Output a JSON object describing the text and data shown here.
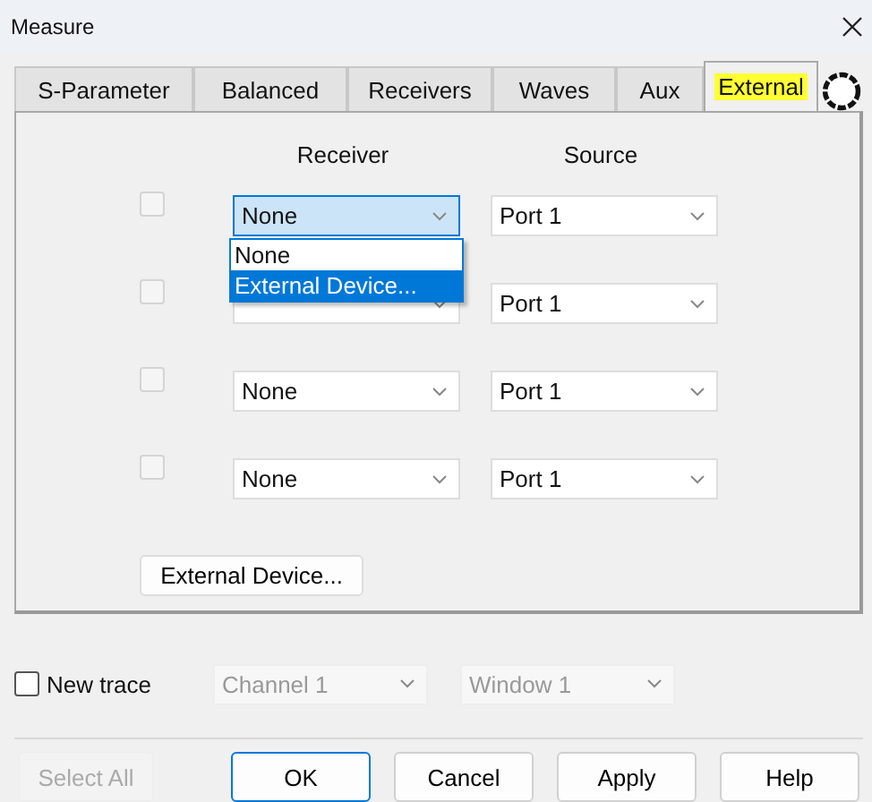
{
  "window": {
    "title": "Measure"
  },
  "tabs": [
    {
      "label": "S-Parameter",
      "selected": false
    },
    {
      "label": "Balanced",
      "selected": false
    },
    {
      "label": "Receivers",
      "selected": false
    },
    {
      "label": "Waves",
      "selected": false
    },
    {
      "label": "Aux",
      "selected": false
    },
    {
      "label": "External",
      "selected": true
    }
  ],
  "columns": [
    "Receiver",
    "Source"
  ],
  "rows": [
    {
      "checked": false,
      "receiver": "None",
      "source": "Port 1",
      "focused": true
    },
    {
      "checked": false,
      "source": "Port 1",
      "focused": false
    },
    {
      "checked": false,
      "receiver": "None",
      "source": "Port 1",
      "focused": false
    },
    {
      "checked": false,
      "receiver": "None",
      "source": "Port 1",
      "focused": false
    }
  ],
  "dropdown": {
    "options": [
      {
        "label": "None",
        "selected": false
      },
      {
        "label": "External Device...",
        "selected": true
      }
    ]
  },
  "external_device_button": "External Device...",
  "new_trace": {
    "label": "New trace",
    "checked": false,
    "channel": {
      "value": "Channel 1",
      "disabled": true
    },
    "window": {
      "value": "Window 1",
      "disabled": true
    }
  },
  "buttons": [
    {
      "label": "Select All",
      "disabled": true,
      "default": false
    },
    {
      "label": "OK",
      "disabled": false,
      "default": true
    },
    {
      "label": "Cancel",
      "disabled": false,
      "default": false
    },
    {
      "label": "Apply",
      "disabled": false,
      "default": false
    },
    {
      "label": "Help",
      "disabled": false,
      "default": false
    }
  ]
}
